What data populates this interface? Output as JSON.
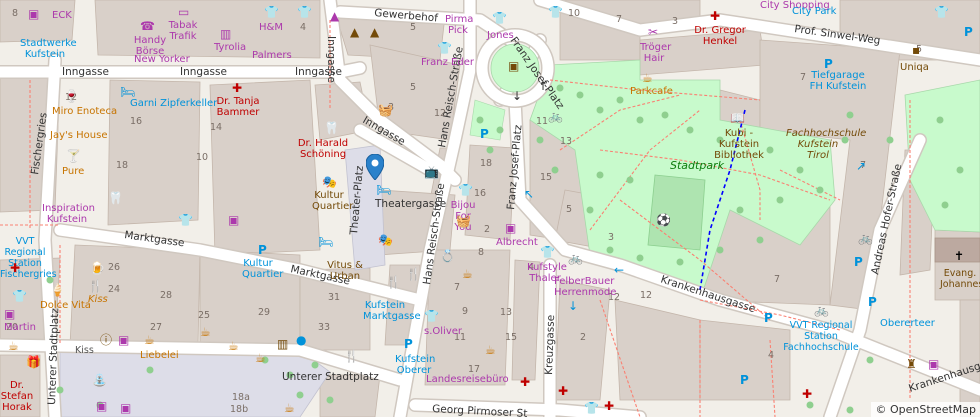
{
  "map": {
    "attribution": "© OpenStreetMap",
    "colors": {
      "background": "#f2efe9",
      "building": "#d9d0c9",
      "building_stroke": "#c4b6ab",
      "park": "#c8facc",
      "park_dark": "#aee4b0",
      "pedestrian": "#dddde8",
      "road": "#ffffff",
      "road_stroke": "#d0c8c0",
      "path": "#fa8072",
      "footway_blue": "#0000ff",
      "amenity": "#ac39ac",
      "food": "#c77400",
      "health": "#bf0000",
      "transport": "#0092da",
      "tree": "#8fcf8f"
    },
    "streets": [
      {
        "name": "Gewerbehof",
        "label": "Gewerbehof"
      },
      {
        "name": "Prof. Sinwel-Weg",
        "label": "Prof. Sinwel-Weg"
      },
      {
        "name": "Inngasse",
        "label": "Inngasse"
      },
      {
        "name": "Marktgasse",
        "label": "Marktgasse"
      },
      {
        "name": "Theatergasse",
        "label": "Theatergasse"
      },
      {
        "name": "Theater-Platz",
        "label": "Theater-Platz"
      },
      {
        "name": "Hans Reisch-Straße",
        "label": "Hans Reisch-Straße"
      },
      {
        "name": "Franz Josef-Platz",
        "label": "Franz Josef-Platz"
      },
      {
        "name": "Krankenhausgasse",
        "label": "Krankenhausgasse"
      },
      {
        "name": "Unterer Stadtplatz",
        "label": "Unterer Stadtplatz"
      },
      {
        "name": "Georg Pirmoser Straße",
        "label": "Georg Pirmoser St"
      },
      {
        "name": "Kreuzgasse",
        "label": "Kreuzgasse"
      },
      {
        "name": "Andreas Hofer-Straße",
        "label": "Andreas Hofer-Straße"
      },
      {
        "name": "Fischergries",
        "label": "Fischergries"
      },
      {
        "name": "Unterer Stadtplatz street",
        "label": "Unterer Stadtplatz"
      }
    ],
    "pois": {
      "eck": "ECK",
      "stadtwerke": "Stadtwerke Kufstein",
      "handy_boerse": "Handy Börse",
      "tabak_trafik": "Tabak Trafik",
      "new_yorker": "New Yorker",
      "tyrolia": "Tyrolia",
      "hm": "H&M",
      "palmers": "Palmers",
      "pirma_pick": "Pirma Pick",
      "jones": "Jones",
      "franz_eder": "Franz Eder",
      "troeger_hair": "Tröger Hair",
      "dr_henkel": "Dr. Gregor Henkel",
      "city_shopping": "City Shopping",
      "city_park": "City Park",
      "uniqa": "Uniqa",
      "tiefgarage": "Tiefgarage FH Kufstein",
      "parkcafe": "Parkcafe",
      "bibliothek": "Kubi - Kufstein Bibliothek",
      "fachhochschule": "Fachhochschule Kufstein Tirol",
      "stadtpark": "Stadtpark",
      "garni": "Garni Zipferkeller",
      "dr_bammer": "Dr. Tanja Bammer",
      "miro": "Miro Enoteca",
      "jays": "Jay's House",
      "pure": "Pure",
      "dr_schoning": "Dr. Harald Schöning",
      "kultur_quartier": "Kultur Quartier",
      "inspiration": "Inspiration Kufstein",
      "vvt_station": "VVT Regional Station Fischergries",
      "bijou": "Bijou For You",
      "albrecht": "Albrecht",
      "vitus": "Vitus & Urban",
      "kultur_quartier_p": "Kultur Quartier",
      "kufstein_marktgasse": "Kufstein Marktgasse",
      "kufstyle": "Kufstyle Thaler",
      "felberbauer": "FelberBauer Herrenmode",
      "dolce_vita": "Dolce Vita",
      "kiss_food": "Kiss",
      "martin": "Martin",
      "liebelei": "Liebelei",
      "kiss": "Kiss",
      "soliver": "s.Oliver",
      "kufstein_oberer": "Kufstein Oberer",
      "landesreise": "Landesreisebüro",
      "dr_horak": "Dr. Stefan Horak",
      "vvt_fachhochschule": "VVT Regional Station Fachhochschule",
      "obererteer": "Obererteer",
      "evang": "Evang. Johanneskirche",
      "krankenhausgasse2": "Krankenhausgasse"
    },
    "house_numbers": [
      "2",
      "3",
      "4",
      "5",
      "6",
      "7",
      "8",
      "9",
      "10",
      "11",
      "12",
      "13",
      "14",
      "15",
      "16",
      "17",
      "18",
      "19",
      "20",
      "21",
      "22",
      "23",
      "24",
      "25",
      "26",
      "27",
      "28",
      "29",
      "31",
      "33",
      "18a",
      "18b"
    ]
  }
}
